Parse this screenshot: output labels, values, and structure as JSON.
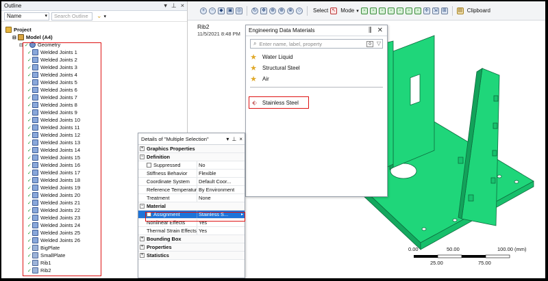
{
  "outline": {
    "title": "Outline",
    "name_dropdown": "Name",
    "search_placeholder": "Search Outline",
    "tree": {
      "project": "Project",
      "model": "Model (A4)",
      "geometry": "Geometry",
      "bodies": [
        "Welded Joints 1",
        "Welded Joints 2",
        "Welded Joints 3",
        "Welded Joints 4",
        "Welded Joints 5",
        "Welded Joints 6",
        "Welded Joints 7",
        "Welded Joints 8",
        "Welded Joints 9",
        "Welded Joints 10",
        "Welded Joints 11",
        "Welded Joints 12",
        "Welded Joints 13",
        "Welded Joints 14",
        "Welded Joints 15",
        "Welded Joints 16",
        "Welded Joints 17",
        "Welded Joints 18",
        "Welded Joints 19",
        "Welded Joints 20",
        "Welded Joints 21",
        "Welded Joints 22",
        "Welded Joints 23",
        "Welded Joints 24",
        "Welded Joints 25",
        "Welded Joints 26"
      ],
      "plates": [
        "BigPlate",
        "SmallPlate",
        "Rib1",
        "Rib2"
      ]
    }
  },
  "toolbar": {
    "select_label": "Select",
    "mode_label": "Mode",
    "clipboard_label": "Clipboard"
  },
  "viewport": {
    "object_name": "Rib2",
    "timestamp": "11/5/2021 8:48 PM",
    "scale": {
      "top_ticks": [
        "0.00",
        "50.00",
        "100.00 (mm)"
      ],
      "bottom_ticks": [
        "25.00",
        "75.00"
      ]
    },
    "model_color": "#1fd67a"
  },
  "engineering_data": {
    "title": "Engineering Data Materials",
    "search_placeholder": "Enter name, label, property",
    "filter_count": "0",
    "favorites": [
      "Water Liquid",
      "Structural Steel",
      "Air"
    ],
    "other_material": "Stainless Steel"
  },
  "details": {
    "title": "Details of \"Multiple Selection\"",
    "sections": {
      "graphics": "Graphics Properties",
      "definition": "Definition",
      "material": "Material",
      "bounding_box": "Bounding Box",
      "properties": "Properties",
      "statistics": "Statistics"
    },
    "rows": {
      "suppressed": {
        "k": "Suppressed",
        "v": "No"
      },
      "stiffness": {
        "k": "Stiffness Behavior",
        "v": "Flexible"
      },
      "coord": {
        "k": "Coordinate System",
        "v": "Default Coor..."
      },
      "reftemp": {
        "k": "Reference Temperature",
        "v": "By Environment"
      },
      "treatment": {
        "k": "Treatment",
        "v": "None"
      },
      "assignment": {
        "k": "Assignment",
        "v": "Stainless S..."
      },
      "nonlinear": {
        "k": "Nonlinear Effects",
        "v": "Yes"
      },
      "thermal": {
        "k": "Thermal Strain Effects",
        "v": "Yes"
      }
    }
  }
}
